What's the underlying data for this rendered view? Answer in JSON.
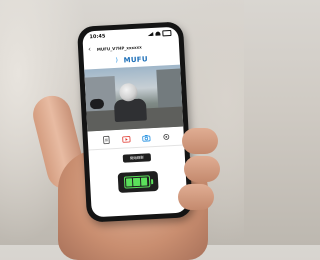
{
  "status_bar": {
    "time": "10:45"
  },
  "nav": {
    "device_name": "MUFU_V7HP_xxxxxx"
  },
  "brand": {
    "name": "MUFU",
    "accent": "#1c6fb8"
  },
  "toolbar": {
    "icons": [
      "file-icon",
      "video-folder-icon",
      "camera-icon",
      "settings-icon"
    ],
    "active_color": "#e0352b",
    "camera_color": "#1c8de0"
  },
  "record_button": {
    "label": "開始錄影"
  },
  "battery": {
    "level": 1.0,
    "color": "#5be05b"
  }
}
